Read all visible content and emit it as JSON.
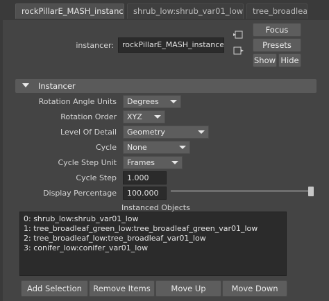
{
  "tabs": [
    {
      "label": "rockPillarE_MASH_instancer",
      "active": true
    },
    {
      "label": "shrub_low:shrub_var01_low",
      "active": false
    },
    {
      "label": "tree_broadleaf",
      "active": false
    }
  ],
  "instancer": {
    "label": "instancer:",
    "value": "rockPillarE_MASH_instancer"
  },
  "buttons": {
    "focus": "Focus",
    "presets": "Presets",
    "show": "Show",
    "hide": "Hide"
  },
  "section": {
    "title": "Instancer"
  },
  "attributes": {
    "rotation_angle_units": {
      "label": "Rotation Angle Units",
      "value": "Degrees"
    },
    "rotation_order": {
      "label": "Rotation Order",
      "value": "XYZ"
    },
    "level_of_detail": {
      "label": "Level Of Detail",
      "value": "Geometry"
    },
    "cycle": {
      "label": "Cycle",
      "value": "None"
    },
    "cycle_step_unit": {
      "label": "Cycle Step Unit",
      "value": "Frames"
    },
    "cycle_step": {
      "label": "Cycle Step",
      "value": "1.000"
    },
    "display_percentage": {
      "label": "Display Percentage",
      "value": "100.000",
      "slider_fraction": 1.0
    }
  },
  "instanced_objects": {
    "title": "Instanced Objects",
    "items": [
      "0: shrub_low:shrub_var01_low",
      "1: tree_broadleaf_green_low:tree_broadleaf_green_var01_low",
      "2: tree_broadleaf_low:tree_broadleaf_var01_low",
      "3: conifer_low:conifer_var01_low"
    ]
  },
  "bottom_buttons": {
    "add_selection": "Add Selection",
    "remove_items": "Remove Items",
    "move_up": "Move Up",
    "move_down": "Move Down"
  }
}
